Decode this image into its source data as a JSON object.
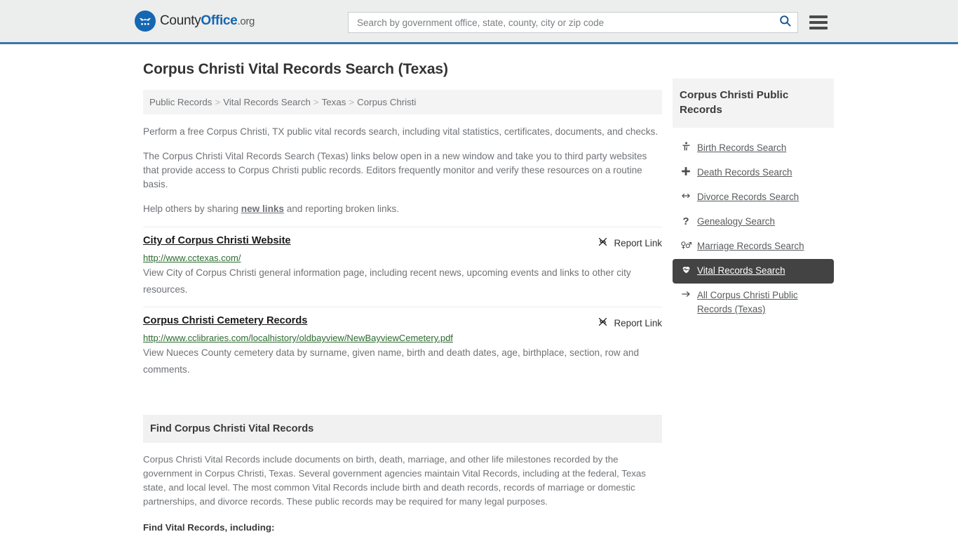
{
  "header": {
    "logo": {
      "part1": "County",
      "part2": "Office",
      "part3": ".org",
      "icon": "eagle-shield-logo-icon"
    },
    "search": {
      "placeholder": "Search by government office, state, county, city or zip code",
      "value": "",
      "icon": "search-icon"
    },
    "menu_icon": "hamburger-menu-icon",
    "accent_color": "#3a76a8",
    "background_color": "#eceded"
  },
  "page": {
    "title": "Corpus Christi Vital Records Search (Texas)"
  },
  "breadcrumb": {
    "separator": ">",
    "items": [
      {
        "label": "Public Records"
      },
      {
        "label": "Vital Records Search"
      },
      {
        "label": "Texas"
      },
      {
        "label": "Corpus Christi"
      }
    ]
  },
  "intro": {
    "p1": "Perform a free Corpus Christi, TX public vital records search, including vital statistics, certificates, documents, and checks.",
    "p2": "The Corpus Christi Vital Records Search (Texas) links below open in a new window and take you to third party websites that provide access to Corpus Christi public records. Editors frequently monitor and verify these resources on a routine basis.",
    "p3_before": "Help others by sharing ",
    "p3_link": "new links",
    "p3_after": " and reporting broken links."
  },
  "results": {
    "report_label": "Report Link",
    "report_icon": "broken-link-icon",
    "items": [
      {
        "title": "City of Corpus Christi Website",
        "url": "http://www.cctexas.com/",
        "description": "View City of Corpus Christi general information page, including recent news, upcoming events and links to other city resources."
      },
      {
        "title": "Corpus Christi Cemetery Records",
        "url": "http://www.cclibraries.com/localhistory/oldbayview/NewBayviewCemetery.pdf",
        "description": "View Nueces County cemetery data by surname, given name, birth and death dates, age, birthplace, section, row and comments."
      }
    ]
  },
  "find_section": {
    "heading": "Find Corpus Christi Vital Records",
    "paragraph": "Corpus Christi Vital Records include documents on birth, death, marriage, and other life milestones recorded by the government in Corpus Christi, Texas. Several government agencies maintain Vital Records, including at the federal, Texas state, and local level. The most common Vital Records include birth and death records, records of marriage or domestic partnerships, and divorce records. These public records may be required for many legal purposes.",
    "lead": "Find Vital Records, including:"
  },
  "sidebar": {
    "heading": "Corpus Christi Public Records",
    "active_color": "#434343",
    "items": [
      {
        "label": "Birth Records Search",
        "icon": "baby-icon",
        "active": false
      },
      {
        "label": "Death Records Search",
        "icon": "cross-icon",
        "active": false
      },
      {
        "label": "Divorce Records Search",
        "icon": "left-right-arrow-icon",
        "active": false
      },
      {
        "label": "Genealogy Search",
        "icon": "question-mark-icon",
        "active": false
      },
      {
        "label": "Marriage Records Search",
        "icon": "venus-mars-icon",
        "active": false
      },
      {
        "label": "Vital Records Search",
        "icon": "heart-pulse-icon",
        "active": true
      },
      {
        "label": "All Corpus Christi Public Records (Texas)",
        "icon": "arrow-right-icon",
        "active": false
      }
    ]
  }
}
